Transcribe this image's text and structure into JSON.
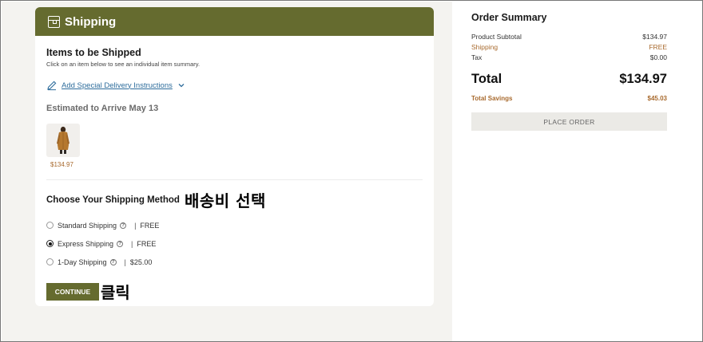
{
  "shipping": {
    "header_title": "Shipping",
    "items_title": "Items to be Shipped",
    "items_subtitle": "Click on an item below to see an individual item summary.",
    "delivery_link": "Add Special Delivery Instructions",
    "arrival": "Estimated to Arrive May 13",
    "item": {
      "price": "$134.97"
    },
    "method_title": "Choose Your Shipping Method",
    "method_annotation": "배송비 선택",
    "options": [
      {
        "label": "Standard Shipping",
        "price": "FREE",
        "selected": false
      },
      {
        "label": "Express Shipping",
        "price": "FREE",
        "selected": true
      },
      {
        "label": "1-Day Shipping",
        "price": "$25.00",
        "selected": false
      }
    ],
    "continue_label": "CONTINUE",
    "continue_annotation": "클릭"
  },
  "summary": {
    "title": "Order Summary",
    "lines": [
      {
        "label": "Product Subtotal",
        "value": "$134.97"
      },
      {
        "label": "Shipping",
        "value": "FREE"
      },
      {
        "label": "Tax",
        "value": "$0.00"
      }
    ],
    "total_label": "Total",
    "total_value": "$134.97",
    "savings_label": "Total Savings",
    "savings_value": "$45.03",
    "place_order_label": "PLACE ORDER"
  },
  "colors": {
    "brand": "#656b2f",
    "accent": "#a86a2e",
    "link": "#2e6d9c"
  }
}
